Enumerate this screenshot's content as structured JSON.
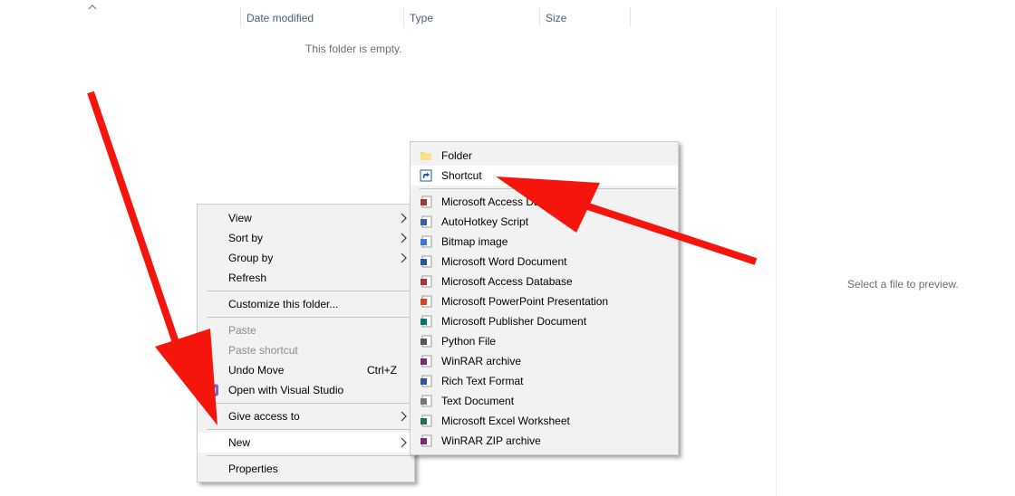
{
  "header": {
    "columns": [
      "Date modified",
      "Type",
      "Size"
    ]
  },
  "content": {
    "empty_message": "This folder is empty."
  },
  "preview": {
    "message": "Select a file to preview."
  },
  "context_menu": {
    "view": "View",
    "sort_by": "Sort by",
    "group_by": "Group by",
    "refresh": "Refresh",
    "customize": "Customize this folder...",
    "paste": "Paste",
    "paste_shortcut": "Paste shortcut",
    "undo_move": "Undo Move",
    "undo_move_accel": "Ctrl+Z",
    "open_vs": "Open with Visual Studio",
    "give_access": "Give access to",
    "new": "New",
    "properties": "Properties"
  },
  "new_submenu": {
    "folder": "Folder",
    "shortcut": "Shortcut",
    "items": [
      {
        "label": "Microsoft Access Da",
        "icon": "access-db-icon",
        "color": "#a4373a"
      },
      {
        "label": "AutoHotkey Script",
        "icon": "ahk-script-icon",
        "color": "#3b5ea8"
      },
      {
        "label": "Bitmap image",
        "icon": "bitmap-icon",
        "color": "#3a7bd5"
      },
      {
        "label": "Microsoft Word Document",
        "icon": "word-doc-icon",
        "color": "#2b579a"
      },
      {
        "label": "Microsoft Access Database",
        "icon": "access-db-icon",
        "color": "#a4373a"
      },
      {
        "label": "Microsoft PowerPoint Presentation",
        "icon": "powerpoint-icon",
        "color": "#d24726"
      },
      {
        "label": "Microsoft Publisher Document",
        "icon": "publisher-icon",
        "color": "#077568"
      },
      {
        "label": "Python File",
        "icon": "python-file-icon",
        "color": "#555555"
      },
      {
        "label": "WinRAR archive",
        "icon": "winrar-icon",
        "color": "#7a2b6e"
      },
      {
        "label": "Rich Text Format",
        "icon": "rtf-icon",
        "color": "#2b579a"
      },
      {
        "label": "Text Document",
        "icon": "text-doc-icon",
        "color": "#777777"
      },
      {
        "label": "Microsoft Excel Worksheet",
        "icon": "excel-icon",
        "color": "#217346"
      },
      {
        "label": "WinRAR ZIP archive",
        "icon": "winrar-zip-icon",
        "color": "#7a2b6e"
      }
    ]
  },
  "annotation_color": "#f5150c"
}
